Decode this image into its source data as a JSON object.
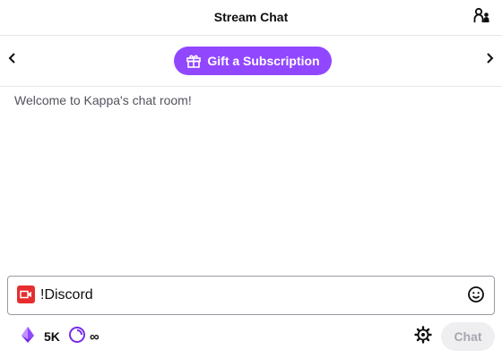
{
  "header": {
    "title": "Stream Chat",
    "users_icon": "users-icon"
  },
  "gift_bar": {
    "prev_icon": "chevron-left-icon",
    "next_icon": "chevron-right-icon",
    "gift_label": "Gift a Subscription",
    "gift_icon": "gift-icon"
  },
  "messages": {
    "welcome": "Welcome to Kappa's chat room!"
  },
  "chat_input": {
    "value": "!Discord",
    "badge_icon": "camera-icon",
    "emote_icon": "smile-icon"
  },
  "bottom_bar": {
    "bits_count": "5K",
    "bits_icon": "bits-icon",
    "points_label": "∞",
    "points_icon": "channel-points-icon",
    "settings_icon": "gear-icon",
    "chat_button_label": "Chat"
  },
  "colors": {
    "accent": "#9147ff",
    "camera_badge": "#e62e2e",
    "bits": "#9147ff",
    "text_muted": "#53535f"
  }
}
